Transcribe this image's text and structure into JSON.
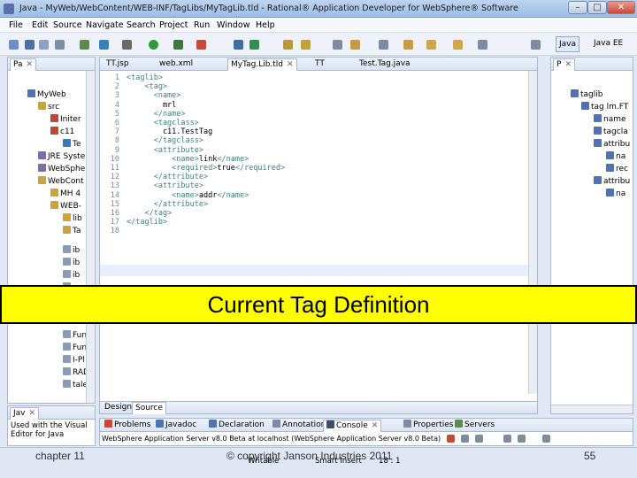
{
  "window": {
    "title": "Java - MyWeb/WebContent/WEB-INF/TagLibs/MyTagLib.tld - Rational® Application Developer for WebSphere® Software",
    "minimize": "–",
    "maximize": "□",
    "close": "✕"
  },
  "menu": [
    "File",
    "Edit",
    "Source",
    "Navigate",
    "Search",
    "Project",
    "Run",
    "Window",
    "Help"
  ],
  "perspectives": {
    "java": "Java",
    "javaee": "Java EE"
  },
  "left_panel": {
    "tab": "Pa",
    "tree": [
      "MyWeb",
      "src",
      "Initer",
      "c11",
      "Te",
      "JRE Syste",
      "WebSphe",
      "WebCont",
      "MH 4",
      "WEB-",
      "lib",
      "Ta",
      "ib",
      "ib",
      "ib",
      "w",
      "Fun-t",
      "Funct",
      "I-Pl",
      "RAD.j",
      "tale"
    ]
  },
  "editor": {
    "tabs": [
      "TT.jsp",
      "web.xml",
      "MyTag.Lib.tld",
      "TT",
      "Test.Tag.java"
    ],
    "lines": [
      {
        "n": "1",
        "segs": [
          {
            "k": "t",
            "v": "<taglib>"
          }
        ]
      },
      {
        "n": "2",
        "segs": [
          {
            "k": "t",
            "v": "    <tag>"
          }
        ]
      },
      {
        "n": "3",
        "segs": [
          {
            "k": "t",
            "v": "      <name>"
          }
        ]
      },
      {
        "n": "4",
        "segs": [
          {
            "k": "c",
            "v": "        mrl"
          }
        ]
      },
      {
        "n": "5",
        "segs": [
          {
            "k": "t",
            "v": "      </name>"
          }
        ]
      },
      {
        "n": "6",
        "segs": [
          {
            "k": "t",
            "v": "      <tagclass>"
          }
        ]
      },
      {
        "n": "7",
        "segs": [
          {
            "k": "c",
            "v": "        c11.TestTag"
          }
        ]
      },
      {
        "n": "8",
        "segs": [
          {
            "k": "t",
            "v": "      </tagclass>"
          }
        ]
      },
      {
        "n": "9",
        "segs": [
          {
            "k": "t",
            "v": "      <attribute>"
          }
        ]
      },
      {
        "n": "10",
        "segs": [
          {
            "k": "t",
            "v": "          <name>"
          },
          {
            "k": "c",
            "v": "link"
          },
          {
            "k": "t",
            "v": "</name>"
          }
        ]
      },
      {
        "n": "11",
        "segs": [
          {
            "k": "t",
            "v": "          <required>"
          },
          {
            "k": "c",
            "v": "true"
          },
          {
            "k": "t",
            "v": "</required>"
          }
        ]
      },
      {
        "n": "12",
        "segs": [
          {
            "k": "t",
            "v": "      </attribute>"
          }
        ]
      },
      {
        "n": "13",
        "segs": [
          {
            "k": "t",
            "v": "      <attribute>"
          }
        ]
      },
      {
        "n": "14",
        "segs": [
          {
            "k": "t",
            "v": "          <name>"
          },
          {
            "k": "c",
            "v": "addr"
          },
          {
            "k": "t",
            "v": "</name>"
          }
        ]
      },
      {
        "n": "15",
        "segs": [
          {
            "k": "t",
            "v": "      </attribute>"
          }
        ]
      },
      {
        "n": "16",
        "segs": [
          {
            "k": "t",
            "v": "    </tag>"
          }
        ]
      },
      {
        "n": "17",
        "segs": [
          {
            "k": "t",
            "v": "</taglib>"
          }
        ]
      },
      {
        "n": "18",
        "segs": [
          {
            "k": "c",
            "v": ""
          }
        ]
      }
    ],
    "bottom_tabs": [
      "Design",
      "Source"
    ]
  },
  "outline": {
    "tab": "P",
    "tree": [
      "taglib",
      "tag lm.FT",
      "name",
      "tagcla",
      "attribu",
      "na",
      "rec",
      "attribu",
      "na"
    ]
  },
  "banner": "Current Tag Definition",
  "lower_left": {
    "tab": "Jav",
    "text": "Used with the Visual Editor for Java"
  },
  "bottom_panel": {
    "tabs": [
      "Problems",
      "Javadoc",
      "Declaration",
      "Annotations",
      "Console",
      "Properties",
      "Servers"
    ],
    "server_line": "WebSphere Application Server v8.0 Beta at localhost (WebSphere Application Server v8.0 Beta)"
  },
  "status": {
    "writable": "Writable",
    "insert": "Smart Insert",
    "pos": "18 : 1"
  },
  "slide": {
    "chapter": "chapter 11",
    "copyright": "© copyright Janson Industries 2011",
    "page": "55"
  }
}
